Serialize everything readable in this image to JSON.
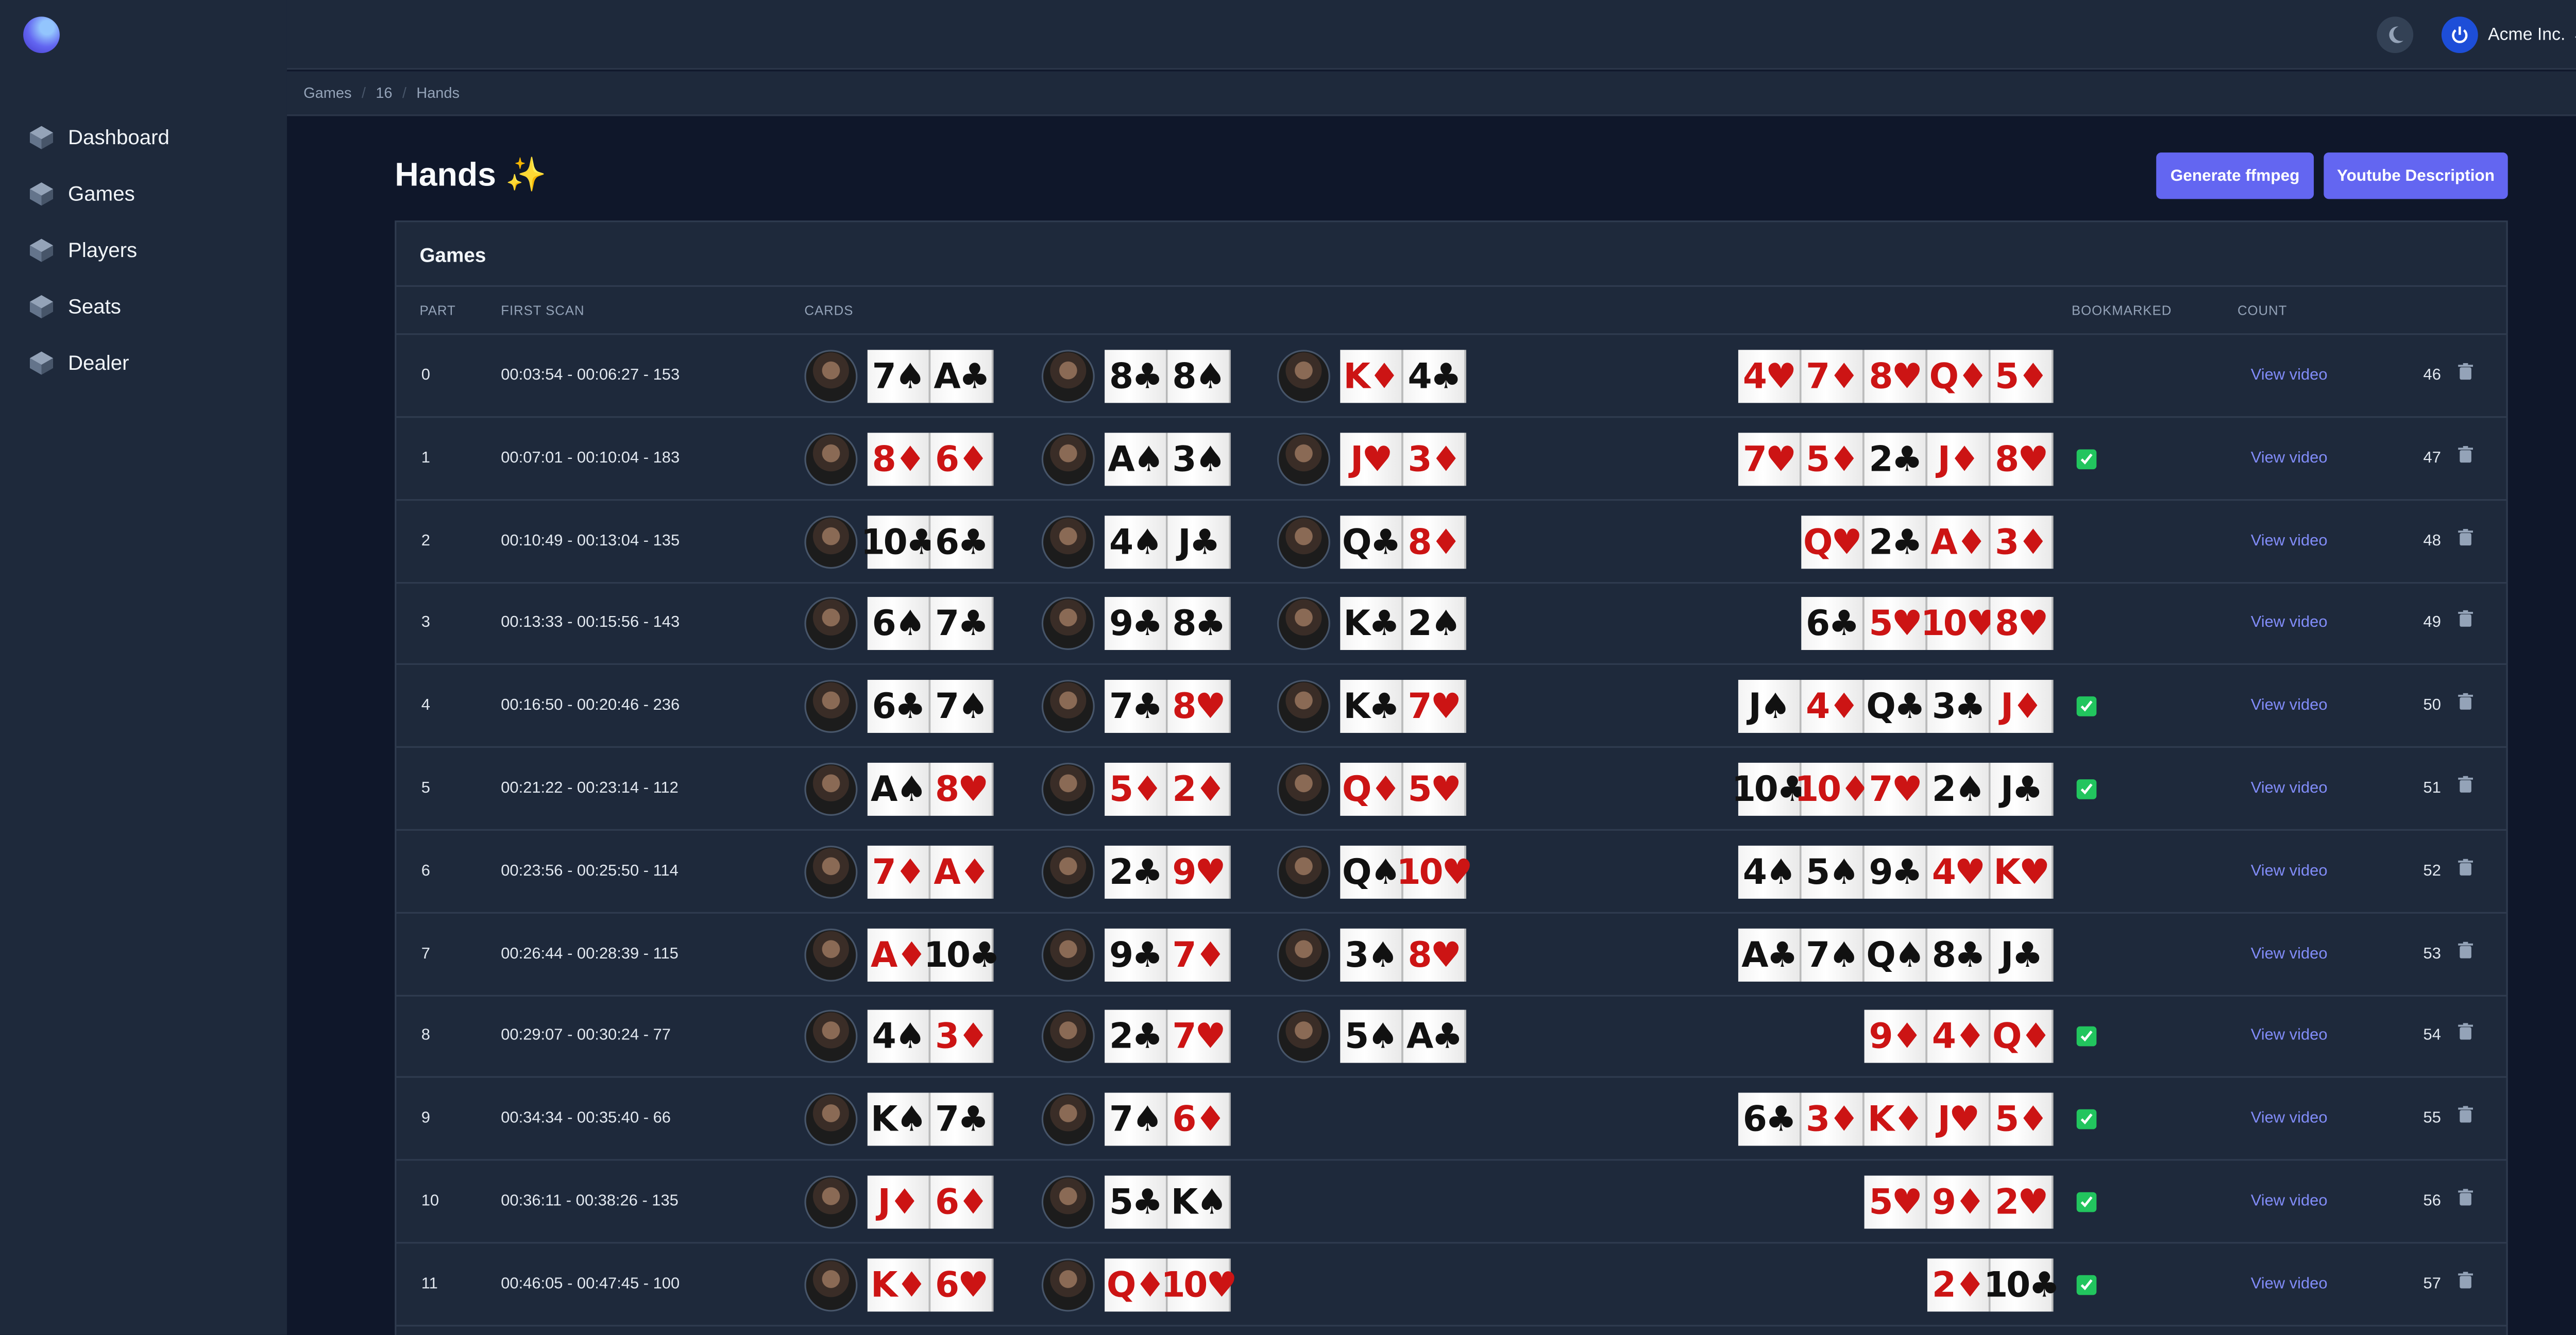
{
  "sidebar": {
    "items": [
      {
        "label": "Dashboard"
      },
      {
        "label": "Games"
      },
      {
        "label": "Players"
      },
      {
        "label": "Seats"
      },
      {
        "label": "Dealer"
      }
    ]
  },
  "topbar": {
    "user": "Acme Inc."
  },
  "breadcrumb": [
    "Games",
    "16",
    "Hands"
  ],
  "page": {
    "title": "Hands ✨"
  },
  "buttons": {
    "ffmpeg": "Generate ffmpeg",
    "youtube": "Youtube Description"
  },
  "panel": {
    "title": "Games"
  },
  "columns": {
    "part": "PART",
    "scan": "FIRST SCAN",
    "cards": "CARDS",
    "bookmarked": "BOOKMARKED",
    "count": "COUNT"
  },
  "rows": [
    {
      "part": "0",
      "scan": "00:03:54 - 00:06:27 - 153",
      "hands": [
        [
          "7♠",
          "A♣"
        ],
        [
          "8♣",
          "8♠"
        ],
        [
          "K♦",
          "4♣"
        ]
      ],
      "board": [
        "4♥",
        "7♦",
        "8♥",
        "Q♦",
        "5♦"
      ],
      "bookmarked": false,
      "view": "View video",
      "count": "46"
    },
    {
      "part": "1",
      "scan": "00:07:01 - 00:10:04 - 183",
      "hands": [
        [
          "8♦",
          "6♦"
        ],
        [
          "A♠",
          "3♠"
        ],
        [
          "J♥",
          "3♦"
        ]
      ],
      "board": [
        "7♥",
        "5♦",
        "2♣",
        "J♦",
        "8♥"
      ],
      "bookmarked": true,
      "view": "View video",
      "count": "47"
    },
    {
      "part": "2",
      "scan": "00:10:49 - 00:13:04 - 135",
      "hands": [
        [
          "10♣",
          "6♣"
        ],
        [
          "4♠",
          "J♣"
        ],
        [
          "Q♣",
          "8♦"
        ]
      ],
      "board": [
        "Q♥",
        "2♣",
        "A♦",
        "3♦"
      ],
      "bookmarked": false,
      "view": "View video",
      "count": "48"
    },
    {
      "part": "3",
      "scan": "00:13:33 - 00:15:56 - 143",
      "hands": [
        [
          "6♠",
          "7♣"
        ],
        [
          "9♣",
          "8♣"
        ],
        [
          "K♣",
          "2♠"
        ]
      ],
      "board": [
        "6♣",
        "5♥",
        "10♥",
        "8♥"
      ],
      "bookmarked": false,
      "view": "View video",
      "count": "49"
    },
    {
      "part": "4",
      "scan": "00:16:50 - 00:20:46 - 236",
      "hands": [
        [
          "6♣",
          "7♠"
        ],
        [
          "7♣",
          "8♥"
        ],
        [
          "K♣",
          "7♥"
        ]
      ],
      "board": [
        "J♠",
        "4♦",
        "Q♣",
        "3♣",
        "J♦"
      ],
      "bookmarked": true,
      "view": "View video",
      "count": "50"
    },
    {
      "part": "5",
      "scan": "00:21:22 - 00:23:14 - 112",
      "hands": [
        [
          "A♠",
          "8♥"
        ],
        [
          "5♦",
          "2♦"
        ],
        [
          "Q♦",
          "5♥"
        ]
      ],
      "board": [
        "10♣",
        "10♦",
        "7♥",
        "2♠",
        "J♣"
      ],
      "bookmarked": true,
      "view": "View video",
      "count": "51"
    },
    {
      "part": "6",
      "scan": "00:23:56 - 00:25:50 - 114",
      "hands": [
        [
          "7♦",
          "A♦"
        ],
        [
          "2♣",
          "9♥"
        ],
        [
          "Q♠",
          "10♥"
        ]
      ],
      "board": [
        "4♠",
        "5♠",
        "9♣",
        "4♥",
        "K♥"
      ],
      "bookmarked": false,
      "view": "View video",
      "count": "52"
    },
    {
      "part": "7",
      "scan": "00:26:44 - 00:28:39 - 115",
      "hands": [
        [
          "A♦",
          "10♣"
        ],
        [
          "9♣",
          "7♦"
        ],
        [
          "3♠",
          "8♥"
        ]
      ],
      "board": [
        "A♣",
        "7♠",
        "Q♠",
        "8♣",
        "J♣"
      ],
      "bookmarked": false,
      "view": "View video",
      "count": "53"
    },
    {
      "part": "8",
      "scan": "00:29:07 - 00:30:24 - 77",
      "hands": [
        [
          "4♠",
          "3♦"
        ],
        [
          "2♣",
          "7♥"
        ],
        [
          "5♠",
          "A♣"
        ]
      ],
      "board": [
        "9♦",
        "4♦",
        "Q♦"
      ],
      "bookmarked": true,
      "view": "View video",
      "count": "54"
    },
    {
      "part": "9",
      "scan": "00:34:34 - 00:35:40 - 66",
      "hands": [
        [
          "K♠",
          "7♣"
        ],
        [
          "7♠",
          "6♦"
        ]
      ],
      "board": [
        "6♣",
        "3♦",
        "K♦",
        "J♥",
        "5♦"
      ],
      "bookmarked": true,
      "view": "View video",
      "count": "55"
    },
    {
      "part": "10",
      "scan": "00:36:11 - 00:38:26 - 135",
      "hands": [
        [
          "J♦",
          "6♦"
        ],
        [
          "5♣",
          "K♠"
        ]
      ],
      "board": [
        "5♥",
        "9♦",
        "2♥"
      ],
      "bookmarked": true,
      "view": "View video",
      "count": "56"
    },
    {
      "part": "11",
      "scan": "00:46:05 - 00:47:45 - 100",
      "hands": [
        [
          "K♦",
          "6♥"
        ],
        [
          "Q♦",
          "10♥"
        ]
      ],
      "board": [
        "2♦",
        "10♣"
      ],
      "bookmarked": true,
      "view": "View video",
      "count": "57"
    }
  ],
  "colors": {
    "accent": "#6366f1",
    "link": "#818cf8",
    "check": "#22c55e",
    "red_suit": "#cc1414"
  }
}
